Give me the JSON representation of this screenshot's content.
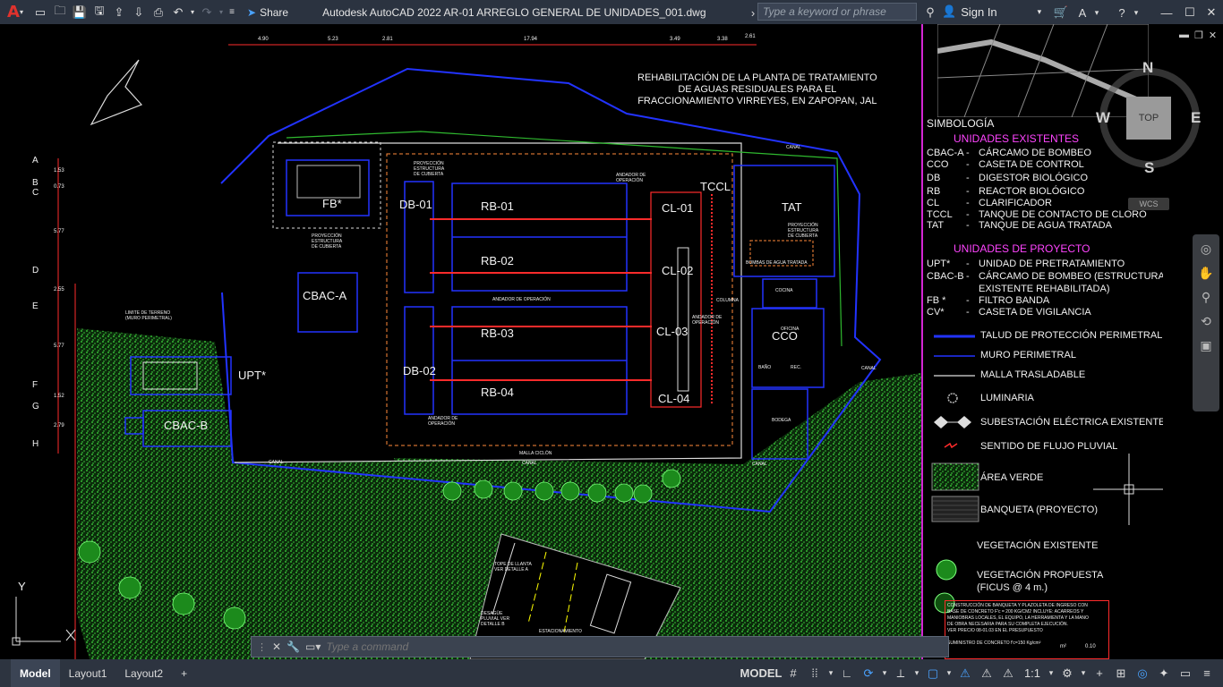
{
  "titlebar": {
    "app_title": "Autodesk AutoCAD 2022    AR-01 ARREGLO GENERAL DE UNIDADES_001.dwg",
    "share_label": "Share",
    "search_placeholder": "Type a keyword or phrase",
    "signin_label": "Sign In"
  },
  "drawing": {
    "project_title": [
      "REHABILITACIÓN DE LA PLANTA DE TRATAMIENTO",
      "DE AGUAS RESIDUALES PARA EL",
      "FRACCIONAMIENTO VIRREYES, EN ZAPOPAN, JAL"
    ],
    "top_dims": [
      "4.90",
      "5.23",
      "2.81",
      "17.94",
      "3.49",
      "3.38",
      "2.61"
    ],
    "axis_letters": [
      "A",
      "B",
      "C",
      "D",
      "E",
      "F",
      "G",
      "H"
    ],
    "axis_dims": [
      "1.53",
      "0.73",
      "5.77",
      "2.55",
      "5.77",
      "1.52",
      "2.79"
    ],
    "units": {
      "fb": "FB*",
      "db01": "DB-01",
      "db02": "DB-02",
      "rb01": "RB-01",
      "rb02": "RB-02",
      "rb03": "RB-03",
      "rb04": "RB-04",
      "cl01": "CL-01",
      "cl02": "CL-02",
      "cl03": "CL-03",
      "cl04": "CL-04",
      "tccl": "TCCL",
      "tat": "TAT",
      "cco": "CCO",
      "cbaca": "CBAC-A",
      "cbacb": "CBAC-B",
      "upt": "UPT*"
    },
    "small_labels": {
      "proy1": "PROYECCIÓN ESTRUCTURA DE CUBIERTA",
      "proy2": "PROYECCIÓN ESTRUCTURA DE CUBIERTA",
      "proy3": "PROYECCIÓN ESTRUCTURA DE CUBIERTA",
      "andador1": "ANDADOR DE OPERACIÓN",
      "andador2": "ANDADOR DE OPERACIÓN",
      "andador3": "ANDADOR DE OPERACIÓN",
      "andador4": "ANDADOR DE OPERACIÓN",
      "columna": "COLUMNA",
      "limite": "LIMITE DE TERRENO (MURO PERIMETRAL)",
      "malla": "MALLA CICLÓN",
      "canal1": "CANAL",
      "canal2": "CANAL",
      "canal3": "CANAL",
      "canal4": "CANAL",
      "canal5": "CANAL",
      "bombas": "BOMBAS DE AGUA TRATADA",
      "cocina": "COCINA",
      "oficina": "OFICINA",
      "bano": "BAÑO",
      "rec": "REC.",
      "bodega": "BODEGA",
      "estacionamiento": "ESTACIONAMIENTO",
      "tope": "TOPE DE LLANTA VER DETALLE A",
      "desague": "DESAGÜE PLUVIAL VER DETALLE B"
    },
    "ucs": {
      "x": "X",
      "y": "Y"
    }
  },
  "legend": {
    "simbologia": "SIMBOLOGÍA",
    "existentes_title": "UNIDADES EXISTENTES",
    "existentes": [
      {
        "key": "CBAC-A",
        "dash": "-",
        "desc": "CÁRCAMO DE BOMBEO"
      },
      {
        "key": "CCO",
        "dash": "-",
        "desc": "CASETA DE CONTROL"
      },
      {
        "key": "DB",
        "dash": "-",
        "desc": "DIGESTOR BIOLÓGICO"
      },
      {
        "key": "RB",
        "dash": "-",
        "desc": "REACTOR BIOLÓGICO"
      },
      {
        "key": "CL",
        "dash": "-",
        "desc": "CLARIFICADOR"
      },
      {
        "key": "TCCL",
        "dash": "-",
        "desc": "TANQUE DE CONTACTO DE CLORO"
      },
      {
        "key": "TAT",
        "dash": "-",
        "desc": "TANQUE DE AGUA TRATADA"
      }
    ],
    "proyecto_title": "UNIDADES DE PROYECTO",
    "proyecto": [
      {
        "key": "UPT*",
        "dash": "-",
        "desc": "UNIDAD DE PRETRATAMIENTO"
      },
      {
        "key": "CBAC-B",
        "dash": "-",
        "desc": "CÁRCAMO DE BOMBEO (ESTRUCTURA"
      },
      {
        "key": "",
        "dash": "",
        "desc": "EXISTENTE REHABILITADA)"
      },
      {
        "key": "FB *",
        "dash": "-",
        "desc": "FILTRO BANDA"
      },
      {
        "key": "CV*",
        "dash": "-",
        "desc": "CASETA DE VIGILANCIA"
      }
    ],
    "symbols": [
      "TALUD DE PROTECCIÓN PERIMETRAL",
      "MURO PERIMETRAL",
      "MALLA TRASLADABLE",
      "LUMINARIA",
      "SUBESTACIÓN ELÉCTRICA EXISTENTE",
      "SENTIDO DE FLUJO PLUVIAL",
      "ÁREA VERDE",
      "BANQUETA (PROYECTO)",
      "VEGETACIÓN EXISTENTE",
      "VEGETACIÓN PROPUESTA",
      "(FICUS @ 4 m.)"
    ],
    "note": [
      "CONSTRUCCIÓN DE BANQUETA Y PLAZOLETA DE INGRESO CON",
      "BASE DE CONCRETO F'c = 200 KG/CM2 INCLUYE: ACARREOS Y",
      "MANIOBRAS LOCALES, EL EQUIPO, LA HERRAMIENTA Y LA MANO",
      "DE OBRA NECESARIA PARA SU COMPLETA EJECUCIÓN.",
      "VER PRECIO 08-01.03 EN EL PRESUPUESTO"
    ],
    "table_row": [
      "SUMINISTRO DE CONCRETO f'c=150 Kg/cm²",
      "m²",
      "0.10"
    ]
  },
  "viewcube": {
    "n": "N",
    "s": "S",
    "e": "E",
    "w": "W",
    "top": "TOP",
    "wcs": "WCS"
  },
  "cmdline": {
    "placeholder": "Type a command"
  },
  "statusbar": {
    "tabs": [
      "Model",
      "Layout1",
      "Layout2"
    ],
    "model_label": "MODEL",
    "scale": "1:1"
  }
}
